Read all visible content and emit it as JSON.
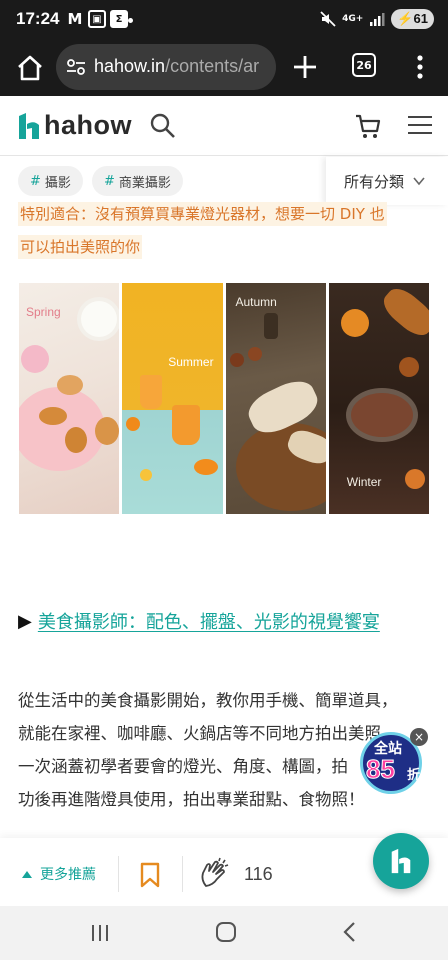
{
  "status_bar": {
    "time": "17:24",
    "left_icons": [
      "gmail-icon",
      "screen-record-icon",
      "sigma-icon"
    ],
    "network": "4G+",
    "battery": "61"
  },
  "browser": {
    "url_host": "hahow.in",
    "url_path": "/contents/ar",
    "tab_count": "26"
  },
  "site": {
    "logo_text": "hahow"
  },
  "tags": [
    {
      "hash": "#",
      "label": "攝影"
    },
    {
      "hash": "#",
      "label": "商業攝影"
    }
  ],
  "category_label": "所有分類",
  "content": {
    "highlight_line1": "特別適合：沒有預算買專業燈光器材，想要一切 DIY 也",
    "highlight_line2": "可以拍出美照的你",
    "photo_labels": [
      "Spring",
      "Summer",
      "Autumn",
      "Winter"
    ],
    "section_arrow": "▶",
    "section_link": "美食攝影師：配色、擺盤、光影的視覺饗宴",
    "para_lines": [
      "從生活中的美食攝影開始，教你用手機、簡單道具，",
      "就能在家裡、咖啡廳、火鍋店等不同地方拍出美照，",
      "一次涵蓋初學者要會的燈光、角度、構圖，拍",
      "功後再進階燈具使用，拍出專業甜點、食物照！"
    ]
  },
  "promo": {
    "line1": "全站",
    "line2": "85",
    "line3": "折",
    "close": "×"
  },
  "actionbar": {
    "more_label": "更多推薦",
    "clap_count": "116"
  },
  "colors": {
    "brand": "#16a49a",
    "highlight_text": "#d9762a",
    "highlight_bg": "#fdf3e3"
  }
}
